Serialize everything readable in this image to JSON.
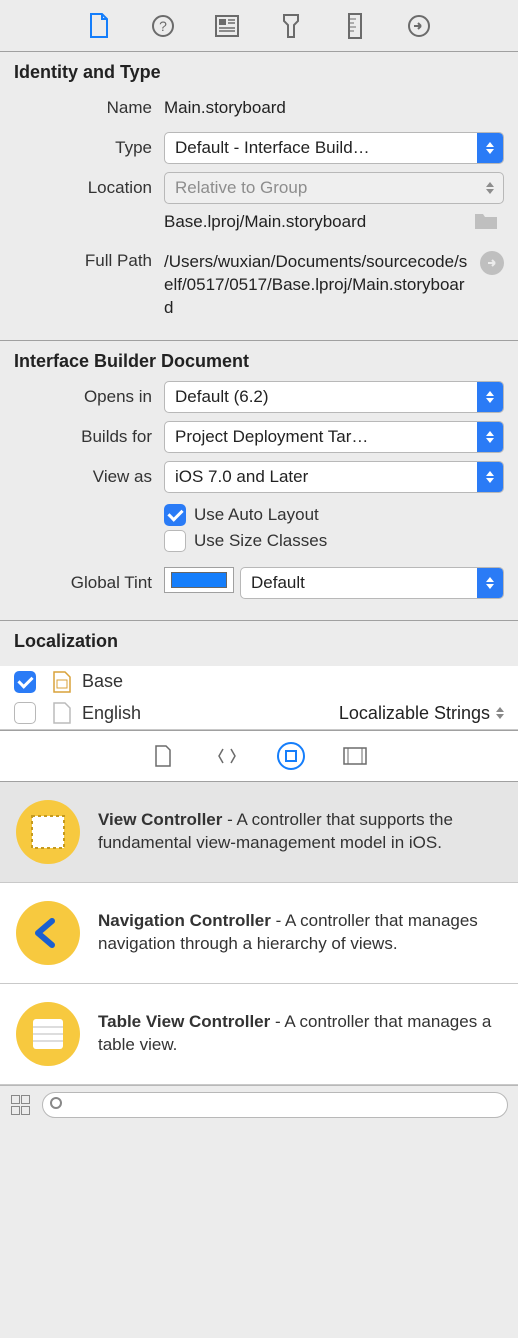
{
  "tabs": {
    "file": "file-icon",
    "help": "help-icon",
    "identity": "identity-icon",
    "attributes": "attributes-icon",
    "size": "size-icon",
    "connections": "connections-icon"
  },
  "identity": {
    "title": "Identity and Type",
    "name_label": "Name",
    "name_value": "Main.storyboard",
    "type_label": "Type",
    "type_value": "Default - Interface Build…",
    "location_label": "Location",
    "location_value": "Relative to Group",
    "location_path": "Base.lproj/Main.storyboard",
    "fullpath_label": "Full Path",
    "fullpath_value": "/Users/wuxian/Documents/sourcecode/self/0517/0517/Base.lproj/Main.storyboard"
  },
  "ibdoc": {
    "title": "Interface Builder Document",
    "opensin_label": "Opens in",
    "opensin_value": "Default (6.2)",
    "buildsfor_label": "Builds for",
    "buildsfor_value": "Project Deployment Tar…",
    "viewas_label": "View as",
    "viewas_value": "iOS 7.0 and Later",
    "autolayout_label": "Use Auto Layout",
    "sizeclasses_label": "Use Size Classes",
    "globaltint_label": "Global Tint",
    "globaltint_value": "Default"
  },
  "localization": {
    "title": "Localization",
    "base_label": "Base",
    "english_label": "English",
    "english_type": "Localizable Strings"
  },
  "library": {
    "items": [
      {
        "title": "View Controller",
        "desc": " - A controller that supports the fundamental view-management model in iOS."
      },
      {
        "title": "Navigation Controller",
        "desc": " - A controller that manages navigation through a hierarchy of views."
      },
      {
        "title": "Table View Controller",
        "desc": " - A controller that manages a table view."
      }
    ]
  }
}
